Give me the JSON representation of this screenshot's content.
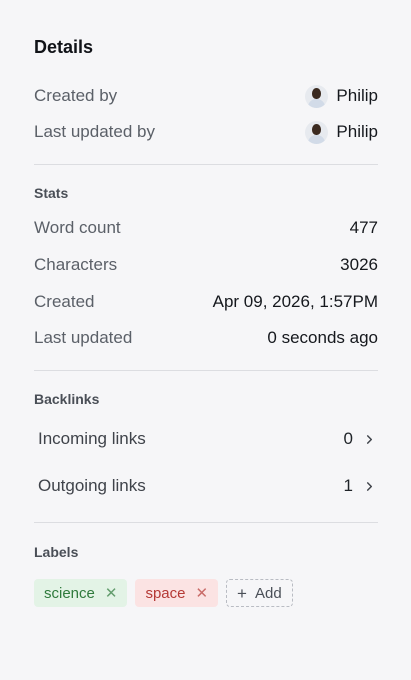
{
  "details": {
    "title": "Details",
    "created_by": {
      "label": "Created by",
      "user": "Philip"
    },
    "last_updated_by": {
      "label": "Last updated by",
      "user": "Philip"
    }
  },
  "stats": {
    "title": "Stats",
    "rows": [
      {
        "label": "Word count",
        "value": "477"
      },
      {
        "label": "Characters",
        "value": "3026"
      },
      {
        "label": "Created",
        "value": "Apr 09, 2026, 1:57PM"
      },
      {
        "label": "Last updated",
        "value": "0 seconds ago"
      }
    ]
  },
  "backlinks": {
    "title": "Backlinks",
    "incoming": {
      "label": "Incoming links",
      "count": "0"
    },
    "outgoing": {
      "label": "Outgoing links",
      "count": "1"
    }
  },
  "labels": {
    "title": "Labels",
    "items": [
      {
        "name": "science",
        "color": "#2f7a3c",
        "bg": "#e3f3e6"
      },
      {
        "name": "space",
        "color": "#b53a36",
        "bg": "#fbe3e3"
      }
    ],
    "add_label": "Add",
    "remove_glyph": "✕",
    "add_glyph": "+"
  }
}
